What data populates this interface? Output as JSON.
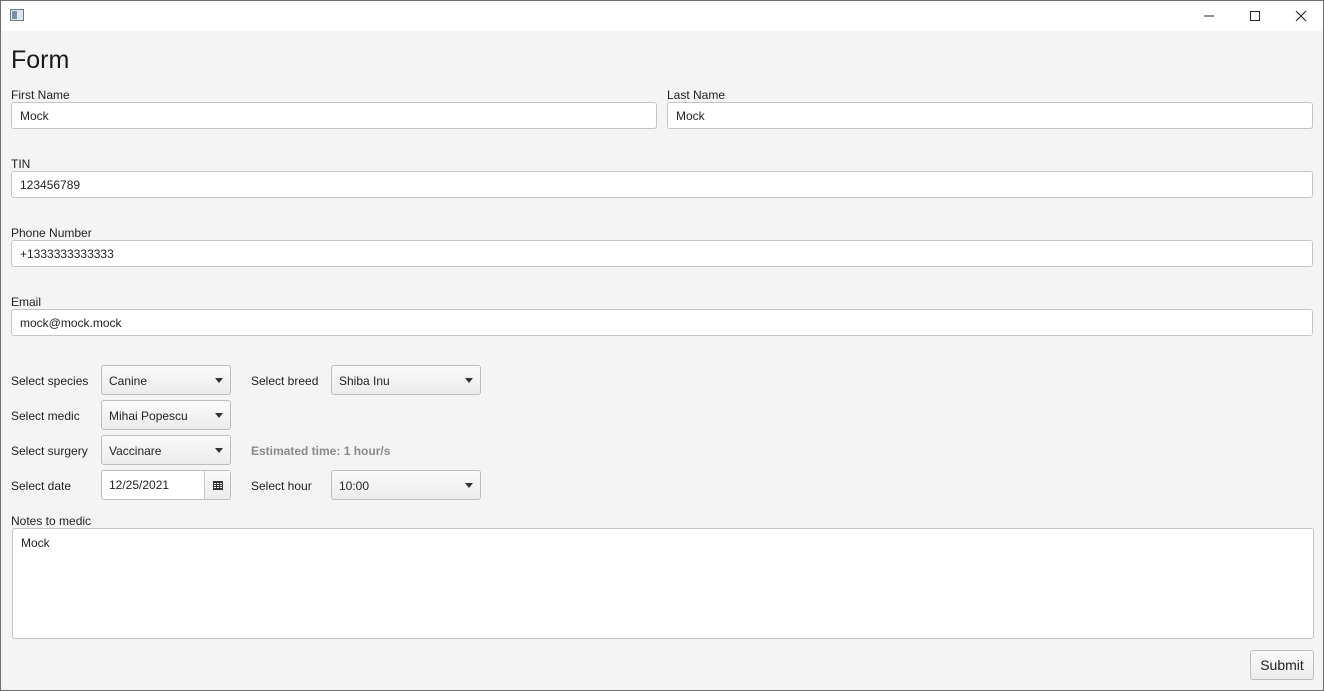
{
  "window": {
    "icons": {
      "app": "app-icon",
      "minimize": "minimize-icon",
      "maximize": "maximize-icon",
      "close": "close-icon"
    }
  },
  "form": {
    "title": "Form",
    "first_name": {
      "label": "First Name",
      "value": "Mock"
    },
    "last_name": {
      "label": "Last Name",
      "value": "Mock"
    },
    "tin": {
      "label": "TIN",
      "value": "123456789"
    },
    "phone": {
      "label": "Phone Number",
      "value": "+1333333333333"
    },
    "email": {
      "label": "Email",
      "value": "mock@mock.mock"
    },
    "species": {
      "label": "Select species",
      "value": "Canine"
    },
    "breed": {
      "label": "Select breed",
      "value": "Shiba Inu"
    },
    "medic": {
      "label": "Select medic",
      "value": "Mihai Popescu"
    },
    "surgery": {
      "label": "Select surgery",
      "value": "Vaccinare"
    },
    "estimated_time": "Estimated time: 1 hour/s",
    "date": {
      "label": "Select date",
      "value": "12/25/2021",
      "icon": "calendar-icon"
    },
    "hour": {
      "label": "Select hour",
      "value": "10:00"
    },
    "notes": {
      "label": "Notes to medic",
      "value": "Mock"
    },
    "submit_label": "Submit"
  }
}
